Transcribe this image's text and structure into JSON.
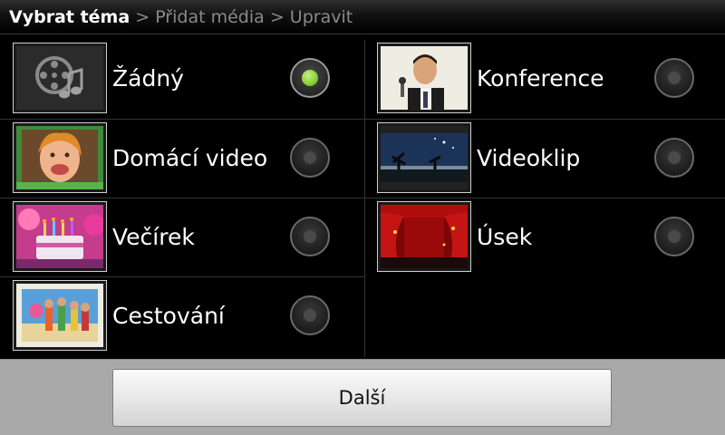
{
  "breadcrumb": {
    "step1": "Vybrat téma",
    "separator": ">",
    "step2": "Přidat média",
    "step3": "Upravit"
  },
  "colors": {
    "selected_radio": "#8bd23a",
    "header_active_text": "#ffffff",
    "header_inactive_text": "#8a8a8a",
    "bottom_bar": "#a9a9a9"
  },
  "themes": [
    {
      "label": "Žádný",
      "icon": "film-music-icon",
      "selected": true
    },
    {
      "label": "Konference",
      "icon": "conference-thumbnail",
      "selected": false
    },
    {
      "label": "Domácí video",
      "icon": "home-video-thumbnail",
      "selected": false
    },
    {
      "label": "Videoklip",
      "icon": "videoclip-thumbnail",
      "selected": false
    },
    {
      "label": "Večírek",
      "icon": "party-thumbnail",
      "selected": false
    },
    {
      "label": "Úsek",
      "icon": "stage-curtain-thumbnail",
      "selected": false
    },
    {
      "label": "Cestování",
      "icon": "travel-thumbnail",
      "selected": false
    }
  ],
  "footer": {
    "next_label": "Další"
  }
}
